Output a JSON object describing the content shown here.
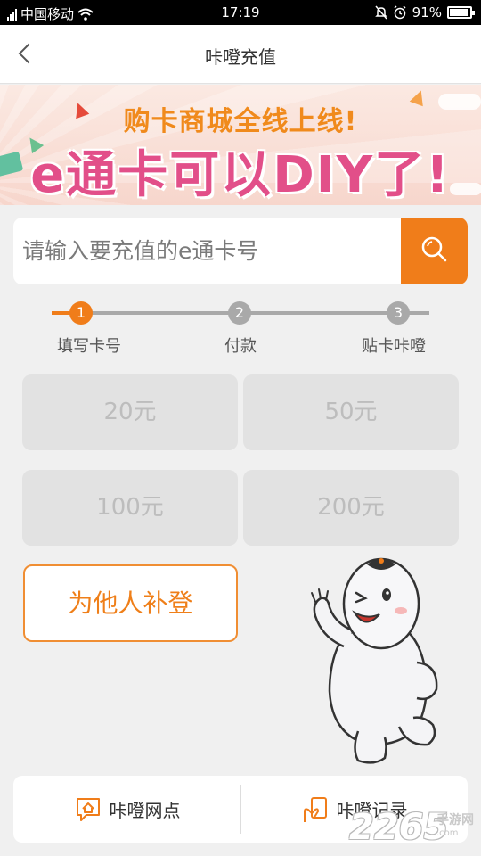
{
  "status_bar": {
    "carrier": "中国移动",
    "time": "17:19",
    "battery": "91%",
    "battery_level": 0.91
  },
  "header": {
    "title": "咔噔充值",
    "back_icon": "chevron-left-icon"
  },
  "banner": {
    "subtitle": "购卡商城全线上线!",
    "title": "e通卡可以DIY了!"
  },
  "search": {
    "placeholder": "请输入要充值的e通卡号",
    "value": "",
    "icon": "search-icon"
  },
  "steps": [
    {
      "number": "1",
      "label": "填写卡号",
      "active": true
    },
    {
      "number": "2",
      "label": "付款",
      "active": false
    },
    {
      "number": "3",
      "label": "贴卡咔噔",
      "active": false
    }
  ],
  "amounts": [
    "20元",
    "50元",
    "100元",
    "200元"
  ],
  "other_button": "为他人补登",
  "bottom_bar": {
    "left_label": "咔噔网点",
    "right_label": "咔噔记录"
  },
  "watermark": {
    "number": "2265",
    "suffix": ".com",
    "text": "手游网"
  },
  "colors": {
    "accent": "#f07d1a",
    "banner_pink": "#e24f89",
    "banner_orange": "#f08a1c",
    "disabled_bg": "#e2e2e2",
    "disabled_text": "#bdbdbd"
  }
}
